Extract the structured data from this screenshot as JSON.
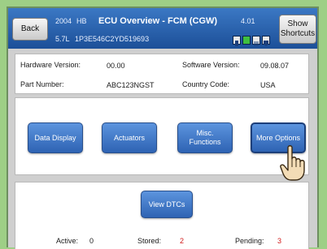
{
  "header": {
    "back_label": "Back",
    "year": "2004",
    "model": "HB",
    "title": "ECU Overview - FCM (CGW)",
    "version": "4.01",
    "engine": "5.7L",
    "vin": "1P3E546C2YD519693",
    "show_label": "Show Shortcuts",
    "status_icons": [
      "battery-icon",
      "signal-icon",
      "engine-icon",
      "shield-icon"
    ]
  },
  "info": {
    "hardware_label": "Hardware Version:",
    "hardware_value": "00.00",
    "software_label": "Software Version:",
    "software_value": "09.08.07",
    "part_label": "Part Number:",
    "part_value": "ABC123NGST",
    "country_label": "Country Code:",
    "country_value": "USA"
  },
  "actions": {
    "data_display": "Data Display",
    "actuators": "Actuators",
    "misc": "Misc. Functions",
    "more_options": "More Options"
  },
  "dtc": {
    "view_label": "View DTCs",
    "active_label": "Active:",
    "active_value": "0",
    "stored_label": "Stored:",
    "stored_value": "2",
    "pending_label": "Pending:",
    "pending_value": "3"
  },
  "colors": {
    "header": "#2a62b0",
    "button": "#3f76c8",
    "dtc_count": "#d11a1a"
  }
}
